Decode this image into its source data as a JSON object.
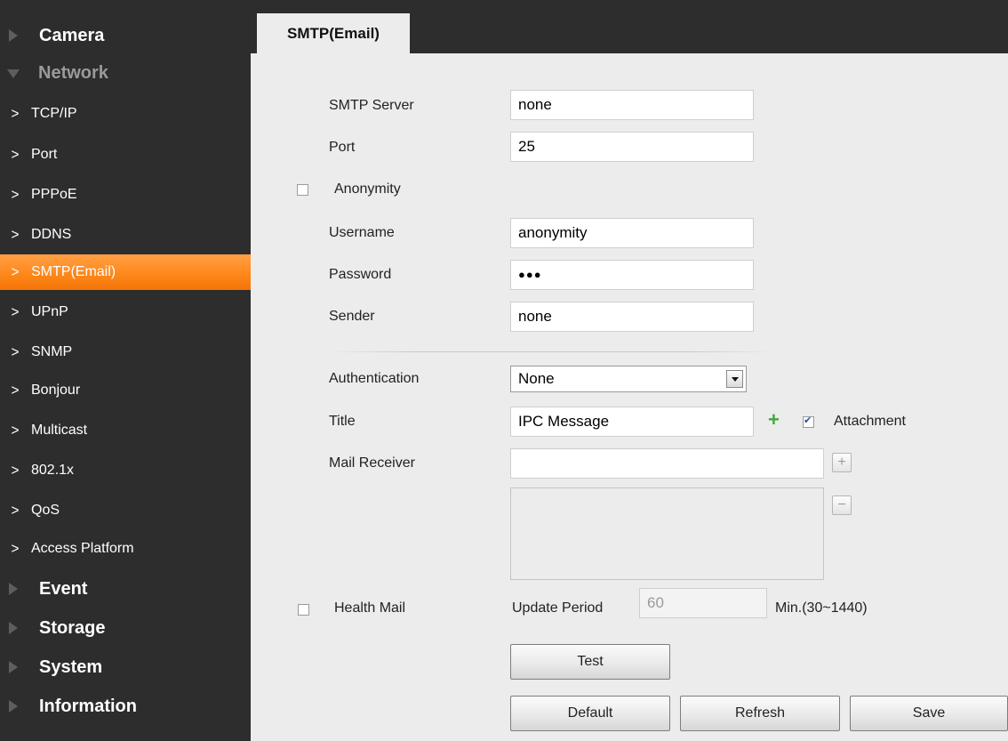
{
  "sidebar": {
    "categories_top": [
      {
        "label": "Camera"
      },
      {
        "label": "Network"
      }
    ],
    "network_items": [
      {
        "label": "TCP/IP"
      },
      {
        "label": "Port"
      },
      {
        "label": "PPPoE"
      },
      {
        "label": "DDNS"
      },
      {
        "label": "SMTP(Email)"
      },
      {
        "label": "UPnP"
      },
      {
        "label": "SNMP"
      },
      {
        "label": "Bonjour"
      },
      {
        "label": "Multicast"
      },
      {
        "label": "802.1x"
      },
      {
        "label": "QoS"
      },
      {
        "label": "Access Platform"
      }
    ],
    "categories_bottom": [
      {
        "label": "Event"
      },
      {
        "label": "Storage"
      },
      {
        "label": "System"
      },
      {
        "label": "Information"
      }
    ],
    "chevron": ">"
  },
  "tab": {
    "label": "SMTP(Email)"
  },
  "form": {
    "smtp_server": {
      "label": "SMTP Server",
      "value": "none"
    },
    "port": {
      "label": "Port",
      "value": "25"
    },
    "anonymity": {
      "label": "Anonymity",
      "checked": false
    },
    "username": {
      "label": "Username",
      "value": "anonymity"
    },
    "password": {
      "label": "Password",
      "value": "●●●"
    },
    "sender": {
      "label": "Sender",
      "value": "none"
    },
    "authentication": {
      "label": "Authentication",
      "value": "None"
    },
    "title": {
      "label": "Title",
      "value": "IPC Message"
    },
    "attachment": {
      "label": "Attachment",
      "checked": true
    },
    "mail_receiver": {
      "label": "Mail Receiver",
      "value": ""
    },
    "health_mail": {
      "label": "Health Mail",
      "checked": false
    },
    "update_period": {
      "label": "Update Period",
      "value": "60",
      "unit": "Min.(30~1440)"
    }
  },
  "buttons": {
    "test": "Test",
    "default": "Default",
    "refresh": "Refresh",
    "save": "Save",
    "add_symbol": "+",
    "remove_symbol": "−"
  },
  "colors": {
    "sidebar_bg": "#2d2d2d",
    "active_item": "#ff8a1e",
    "content_bg": "#ececec",
    "plus_green": "#3ea83e"
  }
}
